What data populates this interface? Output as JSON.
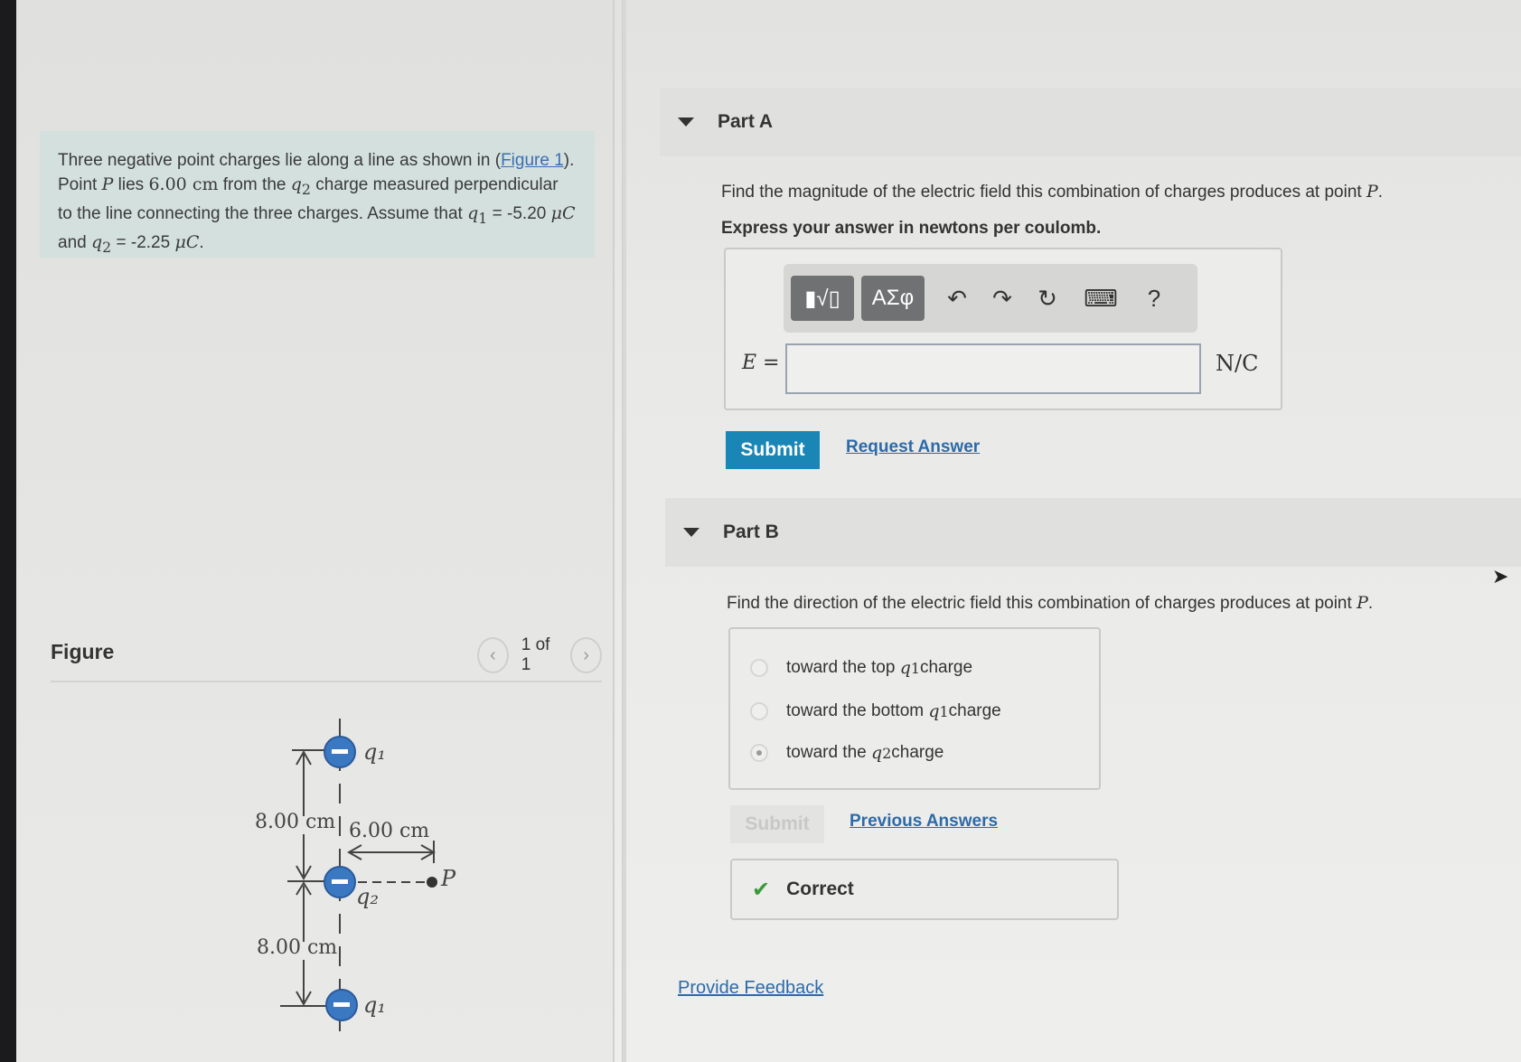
{
  "problem": {
    "text_before_link": "Three negative point charges lie along a line as shown in (",
    "figure_link": "Figure 1",
    "text_a": "). Point ",
    "P": "P",
    "text_b": " lies ",
    "distance": "6.00 cm",
    "text_c": " from the ",
    "q2": "q",
    "q2_sub": "2",
    "text_d": " charge measured perpendicular to the line connecting the three charges. Assume that ",
    "q1": "q",
    "q1_sub": "1",
    "q1_value": " = -5.20 ",
    "unit_muC": "μC",
    "and": " and ",
    "q2_value": " = -2.25 ",
    "end": "."
  },
  "figure": {
    "title": "Figure",
    "pager": "1 of 1",
    "labels": {
      "q1_top": "q₁",
      "q2": "q₂",
      "q1_bottom": "q₁",
      "dist_top": "8.00 cm",
      "dist_bottom": "8.00 cm",
      "dist_horizontal": "6.00 cm",
      "point": "P"
    }
  },
  "partA": {
    "title": "Part A",
    "question_prefix": "Find the magnitude of the electric field this combination of charges produces at point ",
    "question_var": "P",
    "question_suffix": ".",
    "instruction": "Express your answer in newtons per coulomb.",
    "toolbar": {
      "templates": "▮√▯",
      "symbols": "ΑΣφ",
      "undo": "↶",
      "redo": "↷",
      "reset": "↻",
      "keyboard": "⌨",
      "help": "?"
    },
    "eq_label": "E =",
    "input_value": "",
    "unit": "N/C",
    "submit": "Submit",
    "request_answer": "Request Answer"
  },
  "partB": {
    "title": "Part B",
    "question_prefix": "Find the direction of the electric field this combination of charges produces at point ",
    "question_var": "P",
    "question_suffix": ".",
    "options": [
      {
        "pre": "toward the top ",
        "var": "q",
        "sub": "1",
        "post": " charge",
        "selected": false
      },
      {
        "pre": "toward the bottom ",
        "var": "q",
        "sub": "1",
        "post": " charge",
        "selected": false
      },
      {
        "pre": "toward the ",
        "var": "q",
        "sub": "2",
        "post": " charge",
        "selected": true
      }
    ],
    "submit": "Submit",
    "previous_answers": "Previous Answers",
    "result": "Correct"
  },
  "feedback": "Provide Feedback",
  "colors": {
    "accent": "#1a86b5",
    "link": "#2d6aa8",
    "problem_bg": "#d3e0de",
    "charge_blue": "#3b78c2"
  }
}
